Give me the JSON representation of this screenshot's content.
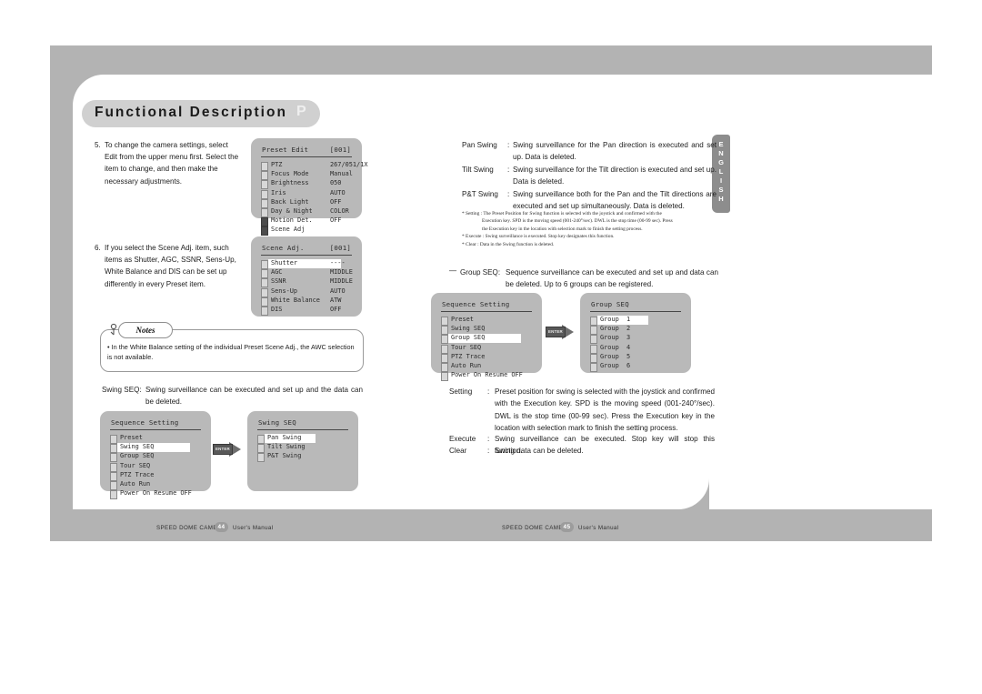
{
  "header": {
    "title": "Functional Description",
    "badge": "P",
    "side_tab": "ENGLISH"
  },
  "left_page": {
    "steps": [
      {
        "number": "5.",
        "text": "To change the camera settings, select Edit from the upper menu first. Select the item to change, and then make the necessary adjustments."
      },
      {
        "number": "6.",
        "text": "If you select the Scene Adj. item, such items as Shutter, AGC, SSNR, Sens-Up, White Balance and DIS can be set up differently in every Preset item."
      }
    ],
    "notes": {
      "title": "Notes",
      "items": [
        "• In the White Balance setting of the individual Preset Scene Adj., the AWC selection is not available."
      ]
    },
    "swing_seq_label": "Swing SEQ:",
    "swing_seq_text": "Swing surveillance can be executed and set up and the data can be deleted.",
    "footer": {
      "brand": "SPEED DOME CAMERA",
      "page": "44",
      "manual": "User's Manual"
    }
  },
  "right_page": {
    "definitions": [
      {
        "label": "Pan Swing",
        "colon": ":",
        "text": "Swing surveillance for the Pan direction is executed and set up. Data is deleted."
      },
      {
        "label": "Tilt Swing",
        "colon": ":",
        "text": "Swing surveillance for the Tilt direction is executed and set up. Data is deleted."
      },
      {
        "label": "P&T Swing",
        "colon": ":",
        "text": "Swing surveillance both for the Pan and the Tilt directions are executed and set up simultaneously. Data is deleted."
      }
    ],
    "footnotes": [
      "* Setting : The Preset Position for Swing function is selected with the joystick and confirmed with the",
      "Execution key.  SPD is the moving speed (001-240°/sec).  DWL is the stop time (00-99 sec).  Press",
      "the Execution key in the location with selection mark to finish the setting process.",
      "* Execute : Swing surveillance is executed. Stop key designates this function.",
      "* Clear : Data in the Swing function is deleted."
    ],
    "group_seq_dash": "—",
    "group_seq_label": "Group SEQ:",
    "group_seq_text": "Sequence surveillance can be executed and set up and data can be deleted. Up to 6 groups can be registered.",
    "settings": [
      {
        "label": "Setting",
        "colon": ":",
        "text": "Preset position for swing is selected with the joystick and confirmed with the Execution key. SPD is the moving speed (001-240°/sec). DWL is the stop time (00-99 sec).  Press the Execution key in the location with selection mark to finish the setting process."
      },
      {
        "label": "Execute",
        "colon": ":",
        "text": "Swing surveillance can be executed.  Stop key will stop this function."
      },
      {
        "label": "Clear",
        "colon": ":",
        "text": "Swing data can be deleted."
      }
    ],
    "footer": {
      "brand": "SPEED DOME CAMERA",
      "page": "45",
      "manual": "User's Manual"
    }
  },
  "osd_menus": {
    "preset_edit": {
      "title": "Preset Edit",
      "index": "[001]",
      "rows": [
        {
          "label": "PTZ",
          "value": "267/051/1X",
          "checked": false,
          "highlight": false
        },
        {
          "label": "Focus Mode",
          "value": "Manual",
          "checked": false,
          "highlight": false
        },
        {
          "label": "Brightness",
          "value": "050",
          "checked": false,
          "highlight": false
        },
        {
          "label": "Iris",
          "value": "AUTO",
          "checked": false,
          "highlight": false
        },
        {
          "label": "Back Light",
          "value": "OFF",
          "checked": false,
          "highlight": false
        },
        {
          "label": "Day & Night",
          "value": "COLOR",
          "checked": false,
          "highlight": false
        },
        {
          "label": "Motion Det.",
          "value": "OFF",
          "checked": true,
          "highlight": false
        },
        {
          "label": "Scene Adj",
          "value": "",
          "checked": true,
          "highlight": true
        }
      ]
    },
    "scene_adj": {
      "title": "Scene Adj.",
      "index": "[001]",
      "rows": [
        {
          "label": "Shutter",
          "value": "----",
          "checked": false,
          "highlight": true
        },
        {
          "label": "AGC",
          "value": "MIDDLE",
          "checked": false,
          "highlight": false
        },
        {
          "label": "SSNR",
          "value": "MIDDLE",
          "checked": false,
          "highlight": false
        },
        {
          "label": "Sens-Up",
          "value": "AUTO",
          "checked": false,
          "highlight": false
        },
        {
          "label": "White Balance",
          "value": "ATW",
          "checked": false,
          "highlight": false
        },
        {
          "label": "DIS",
          "value": "OFF",
          "checked": false,
          "highlight": false
        }
      ]
    },
    "sequence_setting_left": {
      "title": "Sequence Setting",
      "index": "",
      "rows": [
        {
          "label": "Preset",
          "value": "",
          "checked": false,
          "highlight": false
        },
        {
          "label": "Swing SEQ",
          "value": "",
          "checked": false,
          "highlight": true
        },
        {
          "label": "Group SEQ",
          "value": "",
          "checked": false,
          "highlight": false
        },
        {
          "label": "Tour SEQ",
          "value": "",
          "checked": false,
          "highlight": false
        },
        {
          "label": "PTZ Trace",
          "value": "",
          "checked": false,
          "highlight": false
        },
        {
          "label": "Auto Run",
          "value": "",
          "checked": false,
          "highlight": false
        },
        {
          "label": "Power On Resume OFF",
          "value": "",
          "checked": false,
          "highlight": false
        }
      ]
    },
    "swing_seq": {
      "title": "Swing SEQ",
      "index": "",
      "rows": [
        {
          "label": "Pan Swing",
          "value": "",
          "checked": false,
          "highlight": true
        },
        {
          "label": "Tilt Swing",
          "value": "",
          "checked": false,
          "highlight": false
        },
        {
          "label": "P&T Swing",
          "value": "",
          "checked": false,
          "highlight": false
        }
      ]
    },
    "sequence_setting_right": {
      "title": "Sequence Setting",
      "index": "",
      "rows": [
        {
          "label": "Preset",
          "value": "",
          "checked": false,
          "highlight": false
        },
        {
          "label": "Swing SEQ",
          "value": "",
          "checked": false,
          "highlight": false
        },
        {
          "label": "Group SEQ",
          "value": "",
          "checked": false,
          "highlight": true
        },
        {
          "label": "Tour SEQ",
          "value": "",
          "checked": false,
          "highlight": false
        },
        {
          "label": "PTZ Trace",
          "value": "",
          "checked": false,
          "highlight": false
        },
        {
          "label": "Auto Run",
          "value": "",
          "checked": false,
          "highlight": false
        },
        {
          "label": "Power On Resume OFF",
          "value": "",
          "checked": false,
          "highlight": false
        }
      ]
    },
    "group_seq": {
      "title": "Group SEQ",
      "index": "",
      "rows": [
        {
          "label": "Group  1",
          "value": "",
          "checked": false,
          "highlight": true
        },
        {
          "label": "Group  2",
          "value": "",
          "checked": false,
          "highlight": false
        },
        {
          "label": "Group  3",
          "value": "",
          "checked": false,
          "highlight": false
        },
        {
          "label": "Group  4",
          "value": "",
          "checked": false,
          "highlight": false
        },
        {
          "label": "Group  5",
          "value": "",
          "checked": false,
          "highlight": false
        },
        {
          "label": "Group  6",
          "value": "",
          "checked": false,
          "highlight": false
        }
      ]
    }
  },
  "enter_button_label": "ENTER"
}
